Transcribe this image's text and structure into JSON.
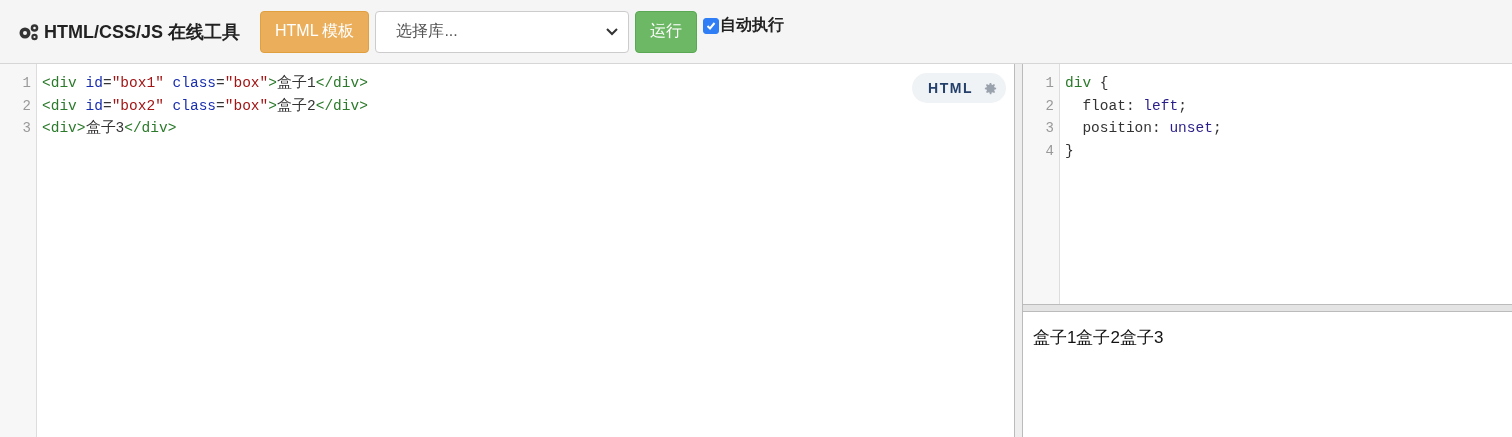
{
  "header": {
    "title": "HTML/CSS/JS 在线工具",
    "template_button": "HTML 模板",
    "library_select": {
      "placeholder": "选择库..."
    },
    "run_button": "运行",
    "auto_run": {
      "label": "自动执行",
      "checked": true
    }
  },
  "html_editor": {
    "mode_badge": "HTML",
    "lines": [
      {
        "number": "1",
        "tokens": [
          {
            "kind": "tag",
            "text": "<div"
          },
          {
            "kind": "attr",
            "text": " id"
          },
          {
            "kind": "punct",
            "text": "="
          },
          {
            "kind": "string",
            "text": "\"box1\""
          },
          {
            "kind": "attr",
            "text": " class"
          },
          {
            "kind": "punct",
            "text": "="
          },
          {
            "kind": "string",
            "text": "\"box\""
          },
          {
            "kind": "tag",
            "text": ">"
          },
          {
            "kind": "text",
            "text": "盒子1"
          },
          {
            "kind": "tag",
            "text": "</div>"
          }
        ]
      },
      {
        "number": "2",
        "tokens": [
          {
            "kind": "tag",
            "text": "<div"
          },
          {
            "kind": "attr",
            "text": " id"
          },
          {
            "kind": "punct",
            "text": "="
          },
          {
            "kind": "string",
            "text": "\"box2\""
          },
          {
            "kind": "attr",
            "text": " class"
          },
          {
            "kind": "punct",
            "text": "="
          },
          {
            "kind": "string",
            "text": "\"box\""
          },
          {
            "kind": "tag",
            "text": ">"
          },
          {
            "kind": "text",
            "text": "盒子2"
          },
          {
            "kind": "tag",
            "text": "</div>"
          }
        ]
      },
      {
        "number": "3",
        "tokens": [
          {
            "kind": "tag",
            "text": "<div>"
          },
          {
            "kind": "text",
            "text": "盒子3"
          },
          {
            "kind": "tag",
            "text": "</div>"
          }
        ]
      }
    ]
  },
  "css_editor": {
    "lines": [
      {
        "number": "1",
        "tokens": [
          {
            "kind": "tag",
            "text": "div"
          },
          {
            "kind": "text",
            "text": " {"
          }
        ]
      },
      {
        "number": "2",
        "tokens": [
          {
            "kind": "text",
            "text": "  float: "
          },
          {
            "kind": "keyword",
            "text": "left"
          },
          {
            "kind": "text",
            "text": ";"
          }
        ]
      },
      {
        "number": "3",
        "tokens": [
          {
            "kind": "text",
            "text": "  position: "
          },
          {
            "kind": "keyword",
            "text": "unset"
          },
          {
            "kind": "text",
            "text": ";"
          }
        ]
      },
      {
        "number": "4",
        "tokens": [
          {
            "kind": "text",
            "text": "}"
          }
        ]
      }
    ]
  },
  "preview": {
    "text": "盒子1盒子2盒子3"
  }
}
